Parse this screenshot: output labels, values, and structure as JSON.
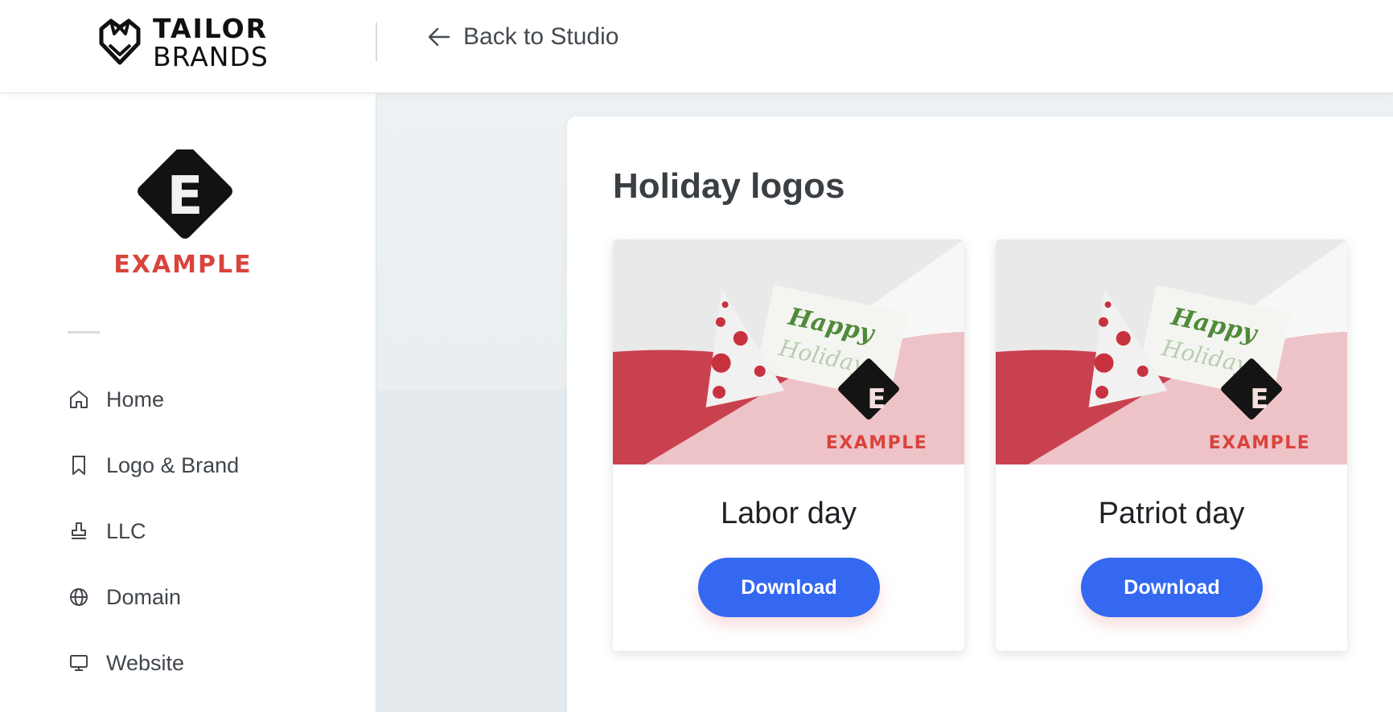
{
  "header": {
    "brand_line1": "TAILOR",
    "brand_line2": "BRANDS",
    "back_label": "Back to Studio"
  },
  "sidebar": {
    "business_name": "EXAMPLE",
    "business_initial": "E",
    "items": [
      {
        "label": "Home",
        "icon": "home-icon"
      },
      {
        "label": "Logo & Brand",
        "icon": "bookmark-icon"
      },
      {
        "label": "LLC",
        "icon": "stamp-icon"
      },
      {
        "label": "Domain",
        "icon": "globe-icon"
      },
      {
        "label": "Website",
        "icon": "monitor-icon"
      }
    ]
  },
  "main": {
    "section_title": "Holiday logos",
    "cards": [
      {
        "title": "Labor day",
        "button": "Download",
        "mockup_text": [
          "Happy",
          "Holidays"
        ],
        "mockup_brand": "EXAMPLE",
        "mockup_initial": "E"
      },
      {
        "title": "Patriot day",
        "button": "Download",
        "mockup_text": [
          "Happy",
          "Holidays"
        ],
        "mockup_brand": "EXAMPLE",
        "mockup_initial": "E"
      }
    ]
  },
  "colors": {
    "accent_blue": "#3468f0",
    "brand_red": "#d8443c",
    "card_red": "#c9414f",
    "card_pink": "#eec3c8"
  }
}
